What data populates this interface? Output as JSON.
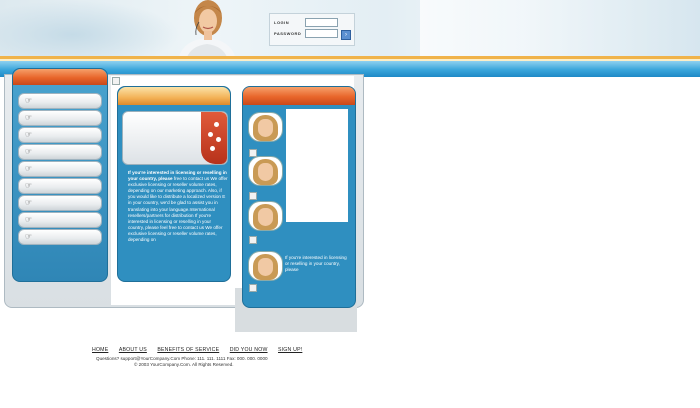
{
  "login": {
    "login_label": "LOGIN",
    "password_label": "PASSWORD",
    "submit_label": "›"
  },
  "nav": {
    "items": [
      {
        "icon": "hand-pointer-icon"
      },
      {
        "icon": "hand-pointer-icon"
      },
      {
        "icon": "hand-pointer-icon"
      },
      {
        "icon": "hand-pointer-icon"
      },
      {
        "icon": "hand-pointer-icon"
      },
      {
        "icon": "hand-pointer-icon"
      },
      {
        "icon": "hand-pointer-icon"
      },
      {
        "icon": "hand-pointer-icon"
      },
      {
        "icon": "hand-pointer-icon"
      }
    ]
  },
  "middle": {
    "lead": "If you're interested in licensing or reselling in your country, please",
    "body": "free to contact us We offer exclusive licensing or reseller volume rates, depending on our marketing approach. Also, if you would like to distribute a localized version E in your country, we'd be glad to assist you in translating into your language.International resellers/partners for distribution If you're interested in licensing or reselling in your country, please feel free to contact us We offer exclusive licensing or reseller volume rates, depending on"
  },
  "right": {
    "text": "If you're interested in licensing or reselling in your country, please"
  },
  "footer": {
    "links": [
      "HOME",
      "ABOUT US",
      "BENEFITS OF SERVICE",
      "DID YOU NOW",
      "SIGN UP!"
    ],
    "contact": "Questions? support@YourCompany.Com Phone: 111. 111. 1111 Fax: 000. 000. 0000",
    "copyright": "© 2003 YourCompany.Com. All Rights Reserved."
  }
}
